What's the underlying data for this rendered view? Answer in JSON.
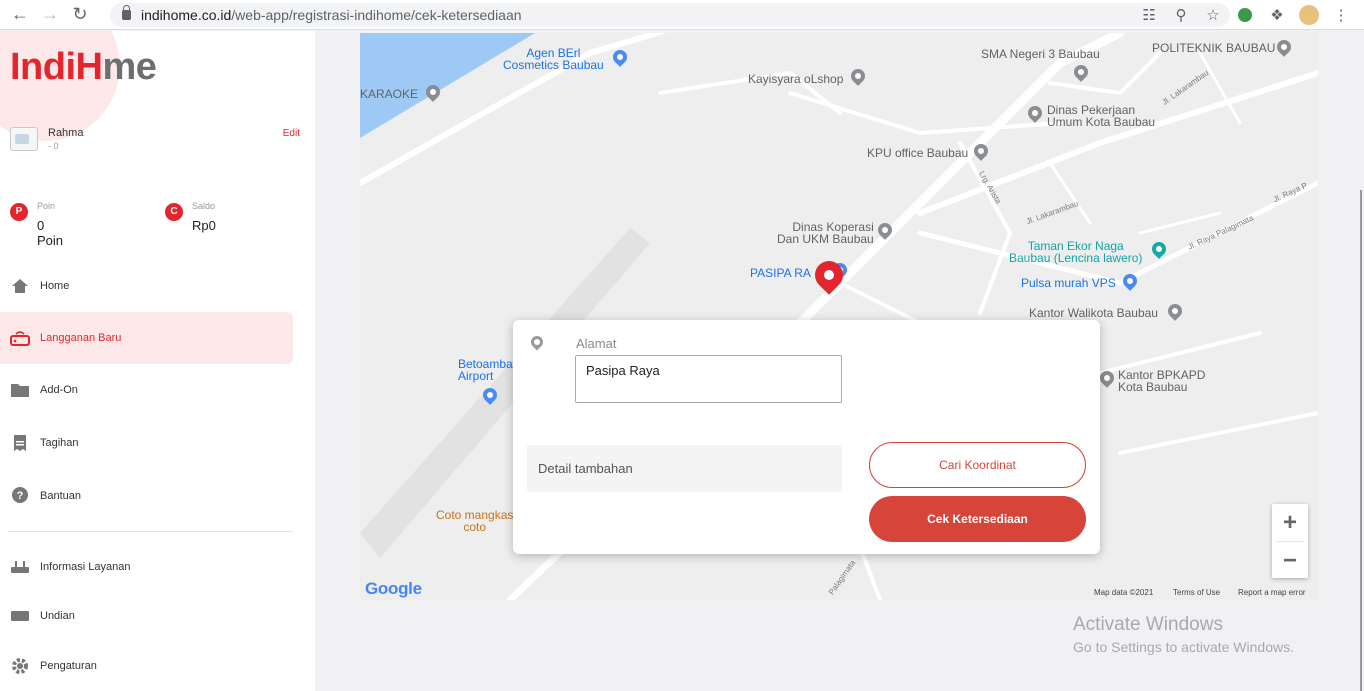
{
  "browser": {
    "url_domain": "indihome.co.id",
    "url_path": "/web-app/registrasi-indihome/cek-ketersediaan",
    "icons": [
      "back-icon",
      "forward-icon",
      "reload-icon",
      "lock-icon",
      "translate-icon",
      "zoom-icon",
      "star-icon",
      "extension-globe-icon",
      "puzzle-icon",
      "profile-icon",
      "menu-icon"
    ]
  },
  "brand": {
    "logo_part1": "IndiH",
    "logo_part2": "me",
    "accent": "#e3262d"
  },
  "profile": {
    "name": "Rahma",
    "sub": "- 0",
    "edit_label": "Edit"
  },
  "wallet": {
    "poin": {
      "badge": "P",
      "label": "Poin",
      "value": "0 Poin"
    },
    "saldo": {
      "badge": "C",
      "label": "Saldo",
      "value": "Rp0"
    }
  },
  "menu": {
    "items": [
      {
        "label": "Home",
        "icon": "home-icon"
      },
      {
        "label": "Langganan Baru",
        "icon": "router-icon",
        "active": true
      },
      {
        "label": "Add-On",
        "icon": "folder-icon"
      },
      {
        "label": "Tagihan",
        "icon": "bill-icon"
      },
      {
        "label": "Bantuan",
        "icon": "help-icon"
      }
    ],
    "secondary": [
      {
        "label": "Informasi Layanan",
        "icon": "modem-icon"
      },
      {
        "label": "Undian",
        "icon": "ticket-icon"
      },
      {
        "label": "Pengaturan",
        "icon": "gear-icon"
      }
    ]
  },
  "map": {
    "places": [
      "Agen BErl\nCosmetics Baubau",
      "KARAOKE",
      "Kayisyara oLshop",
      "SMA Negeri 3 Baubau",
      "POLITEKNIK BAUBAU",
      "Dinas Pekerjaan\nUmum Kota Baubau",
      "KPU office Baubau",
      "Dinas Koperasi\nDan UKM Baubau",
      "PASIPA RA",
      "Taman Ekor Naga\nBaubau (Lencina lawero)",
      "Pulsa murah VPS",
      "Kantor Walikota Baubau",
      "Betoamba\nAirport",
      "Kantor BPKAPD\nKota Baubau",
      "Coto mangkas\ncoto"
    ],
    "streets": [
      "Jl. Lakarambau",
      "Lrg. Arista",
      "Jl. Lakarambau",
      "Jl. Raya Palagimata",
      "Jl. Raya P",
      "Palagimata"
    ],
    "google_logo": "Google",
    "footer": {
      "map_data": "Map data ©2021",
      "terms": "Terms of Use",
      "report": "Report a map error"
    },
    "zoom_in": "+",
    "zoom_out": "−"
  },
  "form": {
    "address_label": "Alamat",
    "address_value": "Pasipa Raya",
    "detail_placeholder": "Detail tambahan",
    "coords_button": "Cari Koordinat",
    "check_button": "Cek Ketersediaan"
  },
  "watermark": {
    "title": "Activate Windows",
    "subtitle": "Go to Settings to activate Windows."
  }
}
